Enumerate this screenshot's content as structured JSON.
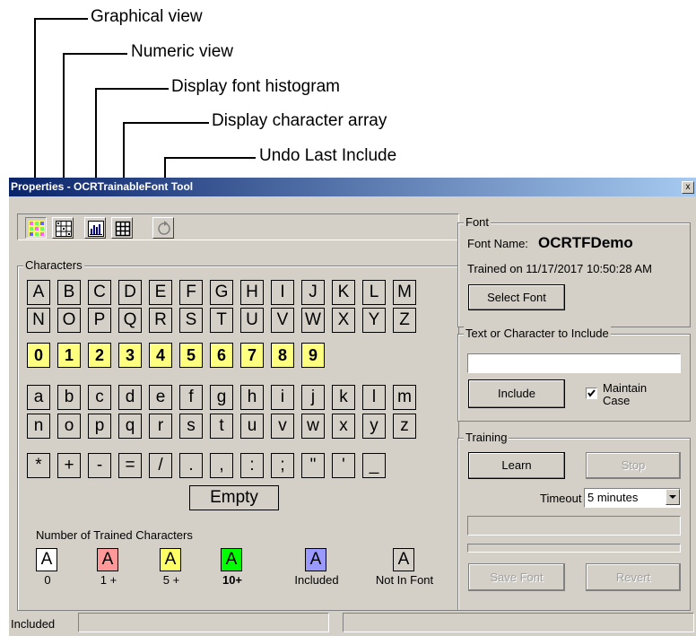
{
  "callouts": {
    "graphical_view": "Graphical view",
    "numeric_view": "Numeric view",
    "font_histogram": "Display font histogram",
    "char_array": "Display character array",
    "undo": "Undo Last Include"
  },
  "window": {
    "title": "Properties - OCRTrainableFont Tool",
    "close_glyph": "x"
  },
  "characters": {
    "group_label": "Characters",
    "uppercase_row1": [
      "A",
      "B",
      "C",
      "D",
      "E",
      "F",
      "G",
      "H",
      "I",
      "J",
      "K",
      "L",
      "M"
    ],
    "uppercase_row2": [
      "N",
      "O",
      "P",
      "Q",
      "R",
      "S",
      "T",
      "U",
      "V",
      "W",
      "X",
      "Y",
      "Z"
    ],
    "digits": [
      "0",
      "1",
      "2",
      "3",
      "4",
      "5",
      "6",
      "7",
      "8",
      "9"
    ],
    "lowercase_row1": [
      "a",
      "b",
      "c",
      "d",
      "e",
      "f",
      "g",
      "h",
      "i",
      "j",
      "k",
      "l",
      "m"
    ],
    "lowercase_row2": [
      "n",
      "o",
      "p",
      "q",
      "r",
      "s",
      "t",
      "u",
      "v",
      "w",
      "x",
      "y",
      "z"
    ],
    "symbols": [
      "*",
      "+",
      "-",
      "=",
      "/",
      ".",
      ",",
      ":",
      ";",
      "\"",
      "'",
      "_"
    ],
    "empty_label": "Empty"
  },
  "legend": {
    "title": "Number of Trained Characters",
    "items": [
      {
        "glyph": "A",
        "label": "0",
        "color": "#ffffff"
      },
      {
        "glyph": "A",
        "label": "1 +",
        "color": "#ff9999"
      },
      {
        "glyph": "A",
        "label": "5 +",
        "color": "#ffff66"
      },
      {
        "glyph": "A",
        "label": "10+",
        "color": "#00ff00"
      },
      {
        "glyph": "A",
        "label": "Included",
        "color": "#9999ff"
      },
      {
        "glyph": "A",
        "label": "Not In Font",
        "color": "#d4d0c8"
      }
    ]
  },
  "font_group": {
    "label": "Font",
    "font_name_label": "Font Name:",
    "font_name_value": "OCRTFDemo",
    "trained_on": "Trained on 11/17/2017 10:50:28 AM",
    "select_font": "Select Font"
  },
  "include_group": {
    "label": "Text or Character to Include",
    "input_value": "",
    "include_button": "Include",
    "maintain_case": "Maintain Case",
    "maintain_case_line1": "Maintain",
    "maintain_case_line2": "Case",
    "maintain_case_checked": true
  },
  "training_group": {
    "label": "Training",
    "learn": "Learn",
    "stop": "Stop",
    "timeout_label": "Timeout",
    "timeout_value": "5 minutes",
    "progress1": 0,
    "progress2": 0,
    "save_font": "Save Font",
    "revert": "Revert"
  },
  "status_bar": {
    "included_label": "Included",
    "field1": "",
    "field2": ""
  }
}
